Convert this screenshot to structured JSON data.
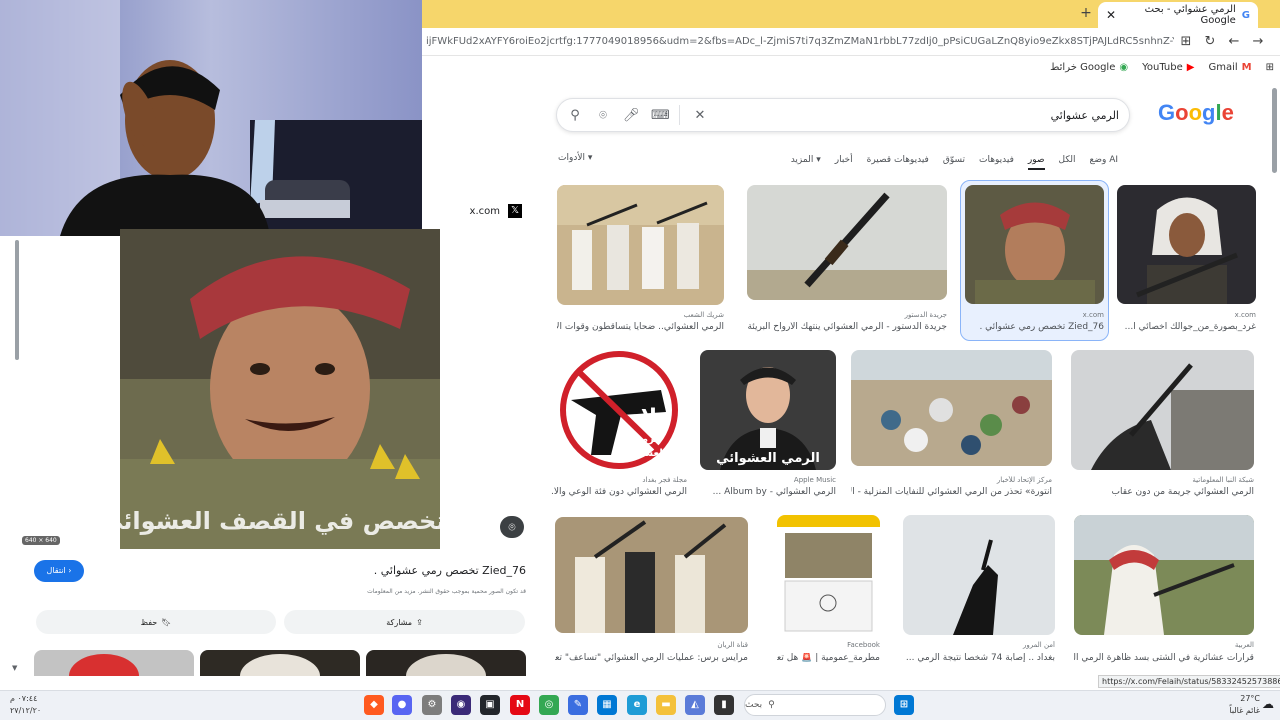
{
  "browser": {
    "tab_title": "الرمي عشوائي - بحث Google",
    "new_tab_label": "+",
    "url": "ijFWkFUd2xAYFY6roiEo2jcrtfg:1777049018956&udm=2&fbs=ADc_l-ZjmiS7ti7q3ZmZMaN1rbbL77zdIj0_pPsiCUGaLZnQ8yio9eZkx8STjPAJLdRC5snhnZ-YzfgIbCDAZTNUAXowrLISepj-fq...",
    "bookmarks": [
      {
        "label": "Gmail",
        "icon": "gmail-icon"
      },
      {
        "label": "YouTube",
        "icon": "youtube-icon"
      },
      {
        "label": "خرائط Google",
        "icon": "maps-icon"
      }
    ]
  },
  "search": {
    "logo": [
      "G",
      "o",
      "o",
      "g",
      "l",
      "e"
    ],
    "query": "الرمي عشوائي",
    "filters": [
      {
        "label": "وضع AI",
        "active": false
      },
      {
        "label": "الكل",
        "active": false
      },
      {
        "label": "صور",
        "active": true
      },
      {
        "label": "فيديوهات",
        "active": false
      },
      {
        "label": "تسوّق",
        "active": false
      },
      {
        "label": "فيديوهات قصيرة",
        "active": false
      },
      {
        "label": "أخبار",
        "active": false
      },
      {
        "label": "المزيد ▾",
        "active": false
      }
    ],
    "tools_label": "الأدوات ▾"
  },
  "results": [
    {
      "source": "شريك الشعب",
      "caption": "الرمي العشوائي.. ضحايا يتساقطون وقوات الأم..."
    },
    {
      "source": "جريدة الدستور",
      "caption": "جريدة الدستور - الرمي العشوائي ينتهك الأرواح البريئة !"
    },
    {
      "source": "x.com",
      "caption": "Zied_76 تخصص رمي عشوائي ."
    },
    {
      "source": "x.com",
      "caption": "غرد_بصورة_من_جوالك اخصائي ا..."
    },
    {
      "source": "مجلة فجر بغداد",
      "caption": "الرمي العشوائي دون فئة الوعي والا..."
    },
    {
      "source": "Apple Music",
      "caption": "الرمي العشوائي - Album by ..."
    },
    {
      "source": "مركز الإتحاد للأخبار",
      "caption": "انتورة» تحذر من الرمي العشوائي للنفايات المنزلية - الات..."
    },
    {
      "source": "شبكة النبأ المعلوماتية",
      "caption": "الرمي العشوائي جريمة من دون عقاب"
    },
    {
      "source": "قناة الريان",
      "caption": "مرايس برس: عمليات الرمي العشوائي \"تساعف\" تعيج..."
    },
    {
      "source": "Facebook",
      "caption": "مطرمة_عمومية | 🚨 هل تعلم..."
    },
    {
      "source": "أمن المرور",
      "caption": "بغداد .. إصابة 74 شخصاً نتيجة الرمي ..."
    },
    {
      "source": "العربية",
      "caption": "قرارات عشائرية في الشتى بسد ظاهرة الرمي المشو..."
    }
  ],
  "thumb_texts": {
    "no_gun_line1": "لا",
    "no_gun_line2": "للرمي",
    "no_gun_line3": "العشوائي",
    "album_title": "الرمي العشوائي",
    "panel_overlay": "متخصص في القصف العشوائي",
    "thumb3_overlay": "متخصص في القصف العشوائي"
  },
  "preview": {
    "source": "x.com",
    "dimensions": "640 × 640",
    "title": "Zied_76 تخصص رمي عشوائي .",
    "note": "قد تكون الصور محمية بموجب حقوق النشر. مزيد من المعلومات",
    "visit_label": "انتقال",
    "share_label": "مشاركة",
    "save_label": "حفظ"
  },
  "status_url": "https://x.com/Felaih/status/583324525738860096",
  "taskbar": {
    "search_placeholder": "بحث",
    "weather_temp": "27°C",
    "weather_desc": "غائم غالباً",
    "time": "٠٧:٤٤ م",
    "date": "٢٧/١٢/٢٠"
  },
  "colors": {
    "tabbar": "#f6d66b",
    "accent": "#1a73e8",
    "selected_border": "#8ab4f8"
  }
}
